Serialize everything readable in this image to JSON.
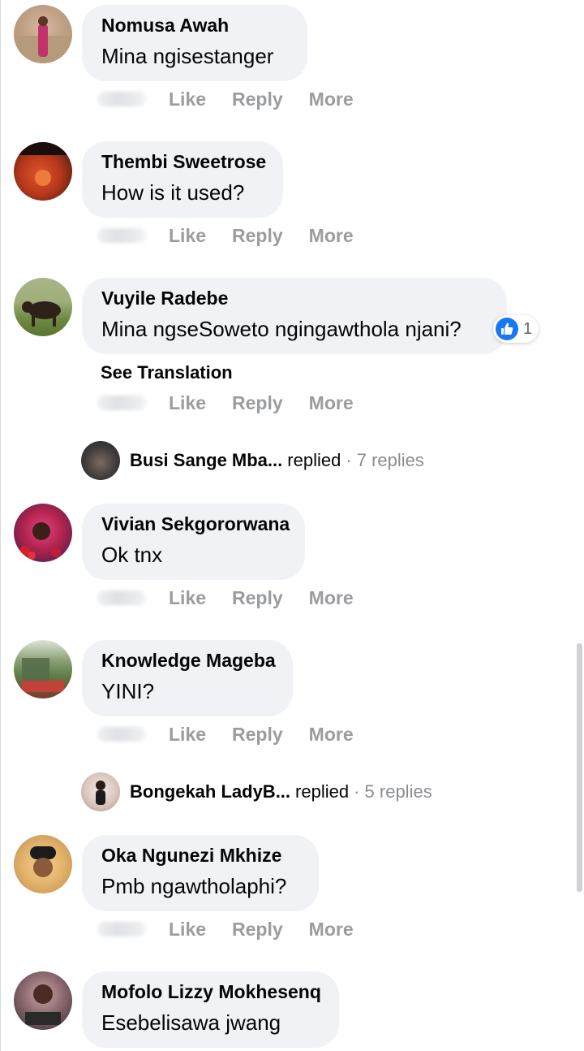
{
  "actions": {
    "like": "Like",
    "reply": "Reply",
    "more": "More"
  },
  "see_translation": "See Translation",
  "comments": [
    {
      "author": "Nomusa Awah",
      "text": "Mina ngisestanger"
    },
    {
      "author": "Thembi Sweetrose",
      "text": "How is it used?"
    },
    {
      "author": "Vuyile Radebe",
      "text": "Mina ngseSoweto ngingawthola njani?",
      "reactions": "1"
    },
    {
      "author": "Vivian Sekgororwana",
      "text": "Ok tnx"
    },
    {
      "author": "Knowledge Mageba",
      "text": "YINI?"
    },
    {
      "author": "Oka Ngunezi Mkhize",
      "text": "Pmb ngawtholaphi?"
    },
    {
      "author": "Mofolo Lizzy Mokhesenq",
      "text": "Esebelisawa jwang"
    }
  ],
  "replies": [
    {
      "name": "Busi Sange Mba...",
      "replied": "replied",
      "count": "· 7 replies"
    },
    {
      "name": "Bongekah LadyB...",
      "replied": "replied",
      "count": "· 5 replies"
    }
  ],
  "colors": {
    "bubble": "#f0f2f5",
    "action_text": "#9a9ca0",
    "like_blue": "#1877f2"
  }
}
